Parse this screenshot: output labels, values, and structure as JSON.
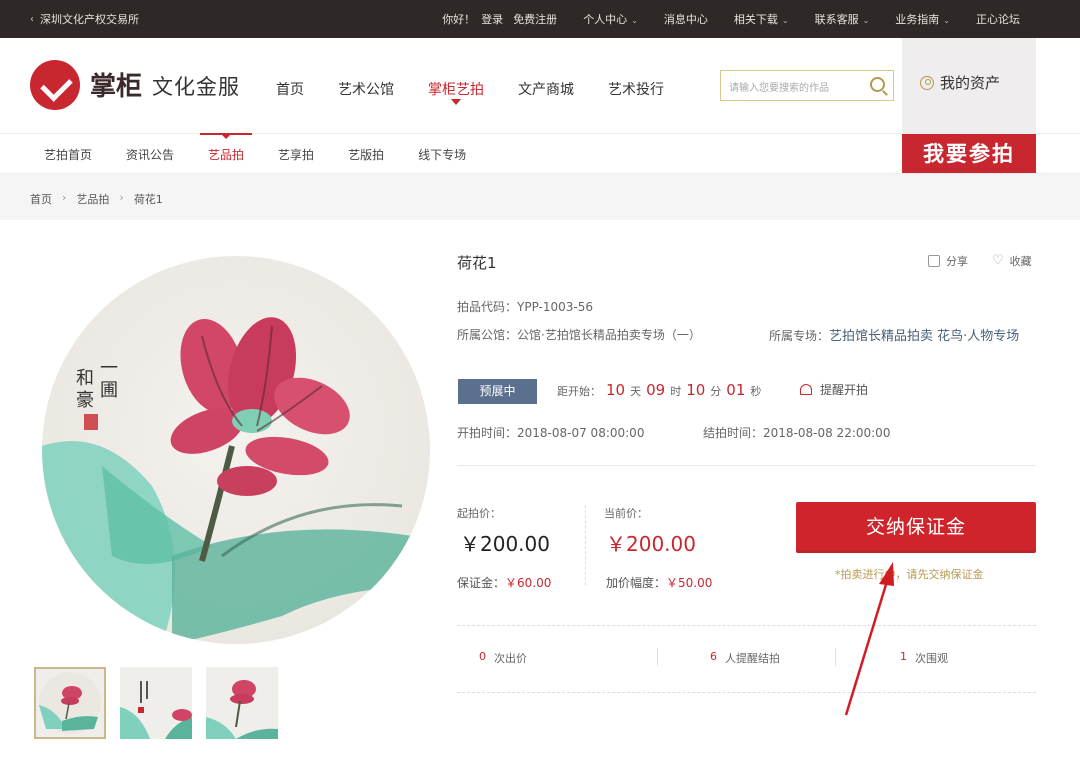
{
  "topbar": {
    "site_name": "深圳文化产权交易所",
    "greeting": "你好！",
    "login": "登录",
    "register": "免费注册",
    "menu": [
      {
        "label": "个人中心",
        "dropdown": true
      },
      {
        "label": "消息中心",
        "dropdown": false
      },
      {
        "label": "相关下载",
        "dropdown": true
      },
      {
        "label": "联系客服",
        "dropdown": true
      },
      {
        "label": "业务指南",
        "dropdown": true
      },
      {
        "label": "正心论坛",
        "dropdown": false
      }
    ]
  },
  "header": {
    "logo_main": "掌柜",
    "logo_sub": "文化金服",
    "nav": [
      "首页",
      "艺术公馆",
      "掌柜艺拍",
      "文产商城",
      "艺术投行"
    ],
    "nav_active": "掌柜艺拍",
    "search_placeholder": "请输入您要搜索的作品",
    "my_assets": "我的资产",
    "bid_banner": "我要参拍"
  },
  "subnav": {
    "items": [
      "艺拍首页",
      "资讯公告",
      "艺品拍",
      "艺享拍",
      "艺版拍",
      "线下专场"
    ],
    "active": "艺品拍"
  },
  "breadcrumb": [
    "首页",
    "艺品拍",
    "荷花1"
  ],
  "product": {
    "title": "荷花1",
    "share": "分享",
    "favorite": "收藏",
    "code_label": "拍品代码：",
    "code": "YPP-1003-56",
    "hall_label": "所属公馆：",
    "hall": "公馆·艺拍馆长精品拍卖专场（一）",
    "session_label": "所属专场：",
    "session": "艺拍馆长精品拍卖 花鸟·人物专场",
    "status": "预展中",
    "countdown": {
      "label": "距开始：",
      "days": "10",
      "days_unit": "天",
      "hours": "09",
      "hours_unit": "时",
      "minutes": "10",
      "minutes_unit": "分",
      "seconds": "01",
      "seconds_unit": "秒"
    },
    "remind": "提醒开拍",
    "start_time": "开拍时间：2018-08-07 08:00:00",
    "end_time": "结拍时间：2018-08-08 22:00:00",
    "start_price_label": "起拍价：",
    "start_price": "￥200.00",
    "current_price_label": "当前价：",
    "current_price": "￥200.00",
    "deposit_label": "保证金：",
    "deposit": "￥60.00",
    "increment_label": "加价幅度：",
    "increment": "￥50.00",
    "cta": "交纳保证金",
    "cta_note": "*拍卖进行中，请先交纳保证金",
    "stats": [
      {
        "num": "0",
        "label": "次出价"
      },
      {
        "num": "6",
        "label": "人提醒结拍"
      },
      {
        "num": "1",
        "label": "次围观"
      }
    ]
  },
  "colors": {
    "accent": "#c8272f",
    "status_bg": "#5b6f8e",
    "topbar_bg": "#2e2826",
    "gold": "#b89a52"
  },
  "painting_inscription": "一圃和豪"
}
